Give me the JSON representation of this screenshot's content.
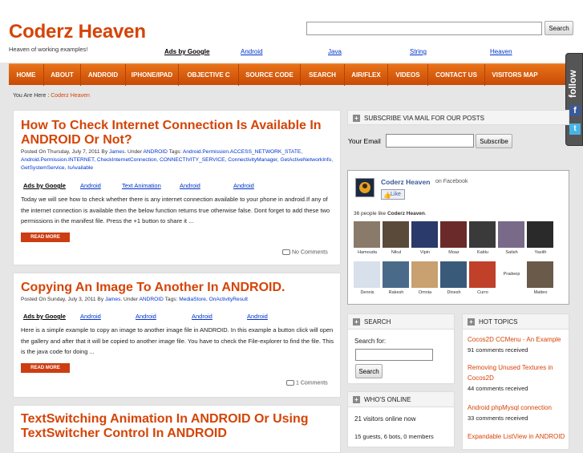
{
  "site": {
    "title": "Coderz Heaven",
    "description": "Heaven of working examples!",
    "search_button": "Search",
    "search_value": ""
  },
  "top_ads": {
    "label": "Ads by Google",
    "links": [
      "Android",
      "Java",
      "String",
      "Heaven"
    ]
  },
  "nav": {
    "items": [
      "HOME",
      "ABOUT",
      "ANDROID",
      "IPHONE/IPAD",
      "OBJECTIVE C",
      "SOURCE CODE",
      "SEARCH",
      "AIR/FLEX",
      "VIDEOS",
      "CONTACT US",
      "VISITORS MAP"
    ]
  },
  "breadcrumb": {
    "prefix": "You Are Here :",
    "current": "Coderz Heaven"
  },
  "follow": {
    "label": "follow",
    "fb": "f",
    "tw": "t"
  },
  "posts": [
    {
      "title": "How To Check Internet Connection Is Available In ANDROID Or Not?",
      "meta_prefix": "Posted On Thursday, July 7, 2011 By",
      "author": "James",
      "under": ". Under",
      "category": "ANDROID",
      "tags_label": "Tags:",
      "tags": "Android.Permission.ACCESS_NETWORK_STATE, Android.Permission.INTERNET, CheckInternetConnection, CONNECTIVITY_SERVICE, ConnectivityManager, GetActiveNetworkInfo, GetSystemService, IsAvailable",
      "ads_label": "Ads by Google",
      "ads": [
        "Android",
        "Text Animation",
        "Android",
        "Android"
      ],
      "excerpt": "Today we will see how to check whether there is any internet connection available to your phone in android.If any of the internet connection is available then the below function returns true otherwise false. Dont forget to add these two permissions in the manifest file. Press the +1 button to share it ...",
      "read_more": "READ MORE",
      "comments": "No Comments"
    },
    {
      "title": "Copying An Image To Another In ANDROID.",
      "meta_prefix": "Posted On Sunday, July 3, 2011 By",
      "author": "James",
      "under": ". Under",
      "category": "ANDROID",
      "tags_label": "Tags:",
      "tags": "MediaStore, OnActivityResult",
      "ads_label": "Ads by Google",
      "ads": [
        "Android",
        "Android",
        "Android",
        "Android"
      ],
      "excerpt": "Here is a simple example to copy an image to another image file in ANDROID. In this example a button click will open the gallery and after that it will be copied to another image file. You have to check the File-explorer to find the file. This is the java code for doing ...",
      "read_more": "READ MORE",
      "comments": "1 Comments"
    },
    {
      "title": "TextSwitching Animation In ANDROID Or Using TextSwitcher Control In ANDROID"
    }
  ],
  "subscribe": {
    "title": "SUBSCRIBE VIA MAIL FOR OUR POSTS",
    "email_label": "Your Email",
    "email_value": "",
    "button": "Subscribe"
  },
  "facebook": {
    "page_name": "Coderz Heaven",
    "on_facebook": "on Facebook",
    "like": "Like",
    "likes_text": "36 people like",
    "likes_name": "Coderz Heaven",
    "people": [
      "Hamouda",
      "Nikul",
      "Vipin",
      "Moaz",
      "Kablu",
      "Satish",
      "Yasith",
      "Dennis",
      "Rakesh",
      "Omnia",
      "Dinesh",
      "Curro",
      "Pradeep",
      "Matteo"
    ]
  },
  "search_widget": {
    "title": "SEARCH",
    "label": "Search for:",
    "value": "",
    "button": "Search"
  },
  "whos_online": {
    "title": "WHO'S ONLINE",
    "visitors": "21 visitors online now",
    "detail": "15 guests, 6 bots, 0 members"
  },
  "hot_topics": {
    "title": "HOT TOPICS",
    "items": [
      {
        "title": "Cocos2D CCMenu - An Example",
        "count": "91 comments received"
      },
      {
        "title": "Removing Unused Textures in Cocos2D",
        "count": "44 comments received"
      },
      {
        "title": "Android phpMysql connection",
        "count": "33 comments received"
      },
      {
        "title": "Expandable ListView in ANDROID"
      }
    ]
  }
}
